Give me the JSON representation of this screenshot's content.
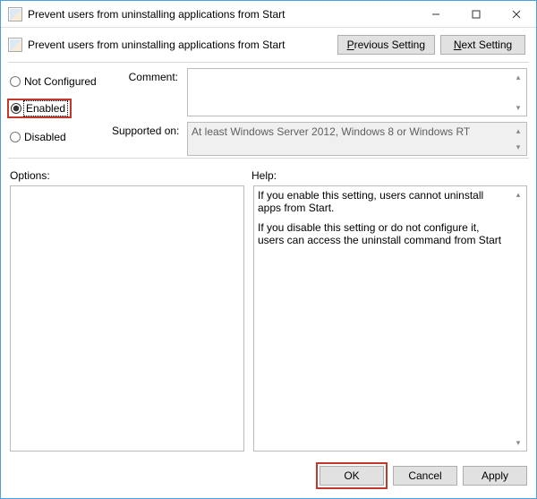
{
  "window": {
    "title": "Prevent users from uninstalling applications from Start"
  },
  "header": {
    "policy_name": "Prevent users from uninstalling applications from Start",
    "prev": "Previous Setting",
    "next": "Next Setting"
  },
  "state": {
    "not_configured": "Not Configured",
    "enabled": "Enabled",
    "disabled": "Disabled",
    "selected": "enabled"
  },
  "labels": {
    "comment": "Comment:",
    "supported": "Supported on:",
    "options": "Options:",
    "help": "Help:"
  },
  "fields": {
    "comment": "",
    "supported": "At least Windows Server 2012, Windows 8 or Windows RT",
    "options": ""
  },
  "help": {
    "p1": "If you enable this setting, users cannot uninstall apps from Start.",
    "p2": "If you disable this setting or do not configure it, users can access the uninstall command from Start"
  },
  "buttons": {
    "ok": "OK",
    "cancel": "Cancel",
    "apply": "Apply"
  }
}
